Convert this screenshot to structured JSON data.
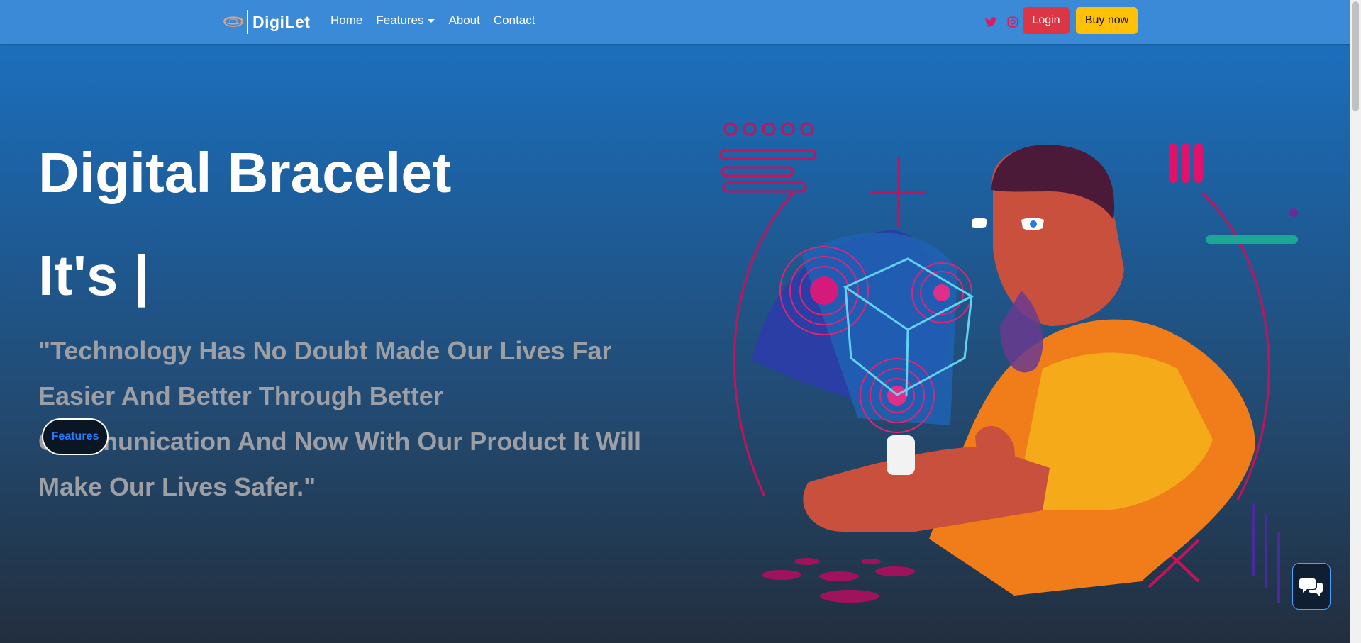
{
  "nav": {
    "brand_name": "DigiLet",
    "links": [
      "Home",
      "Features",
      "About",
      "Contact"
    ],
    "login_label": "Login",
    "buy_label": "Buy now",
    "icons": [
      "bracelet-logo-icon",
      "twitter-icon",
      "instagram-icon"
    ]
  },
  "hero": {
    "title": "Digital Bracelet",
    "typed_text": "It's |",
    "quote": "\"Technology Has No Doubt Made Our Lives Far Easier And Better Through Better Communication And Now With Our Product It Will Make Our Lives Safer.\"",
    "features_label": "Features"
  },
  "colors": {
    "navbar": "#3a8ad8",
    "login": "#dc3545",
    "buy": "#ffc107",
    "quote_text": "#9e9fa4",
    "features_text": "#2979ff",
    "social_icons": "#e0195c"
  },
  "chat": {
    "icon": "chat-bubbles-icon"
  }
}
